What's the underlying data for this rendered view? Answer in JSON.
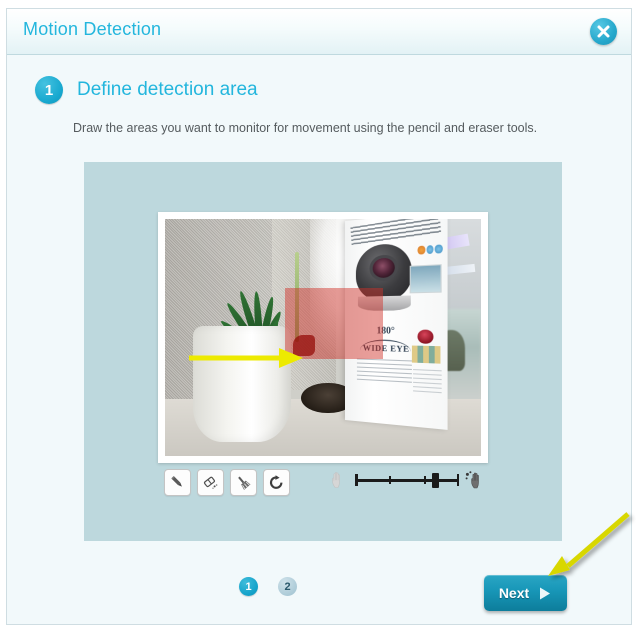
{
  "window": {
    "title": "Motion Detection",
    "close_icon": "close-icon",
    "accent_color": "#23b6dd",
    "titlebar_bg": "#e3f2f5",
    "body_bg": "#f2f9fb"
  },
  "step": {
    "number": "1",
    "title": "Define detection area",
    "description": "Draw the areas you want to monitor for movement using the pencil and eraser tools."
  },
  "preview": {
    "panel_bg": "#bdd8dd",
    "detection_overlay_color": "#d03028",
    "scene": {
      "poster_180": "180°",
      "poster_wide_eye": "WIDE EYE"
    }
  },
  "toolbar": {
    "tools": [
      {
        "name": "pencil-tool",
        "icon": "pencil-icon",
        "selected": false
      },
      {
        "name": "eraser-tool",
        "icon": "eraser-icon",
        "selected": false
      },
      {
        "name": "clear-brush-tool",
        "icon": "brush-icon",
        "selected": false
      },
      {
        "name": "reset-tool",
        "icon": "refresh-icon",
        "selected": false
      }
    ],
    "sensitivity": {
      "low_icon": "hand-still-icon",
      "high_icon": "hand-motion-icon",
      "value": 75,
      "min": 0,
      "max": 100,
      "ticks": [
        0,
        33,
        66,
        100
      ]
    }
  },
  "footer": {
    "pages": [
      {
        "label": "1",
        "active": true
      },
      {
        "label": "2",
        "active": false
      }
    ],
    "next_label": "Next",
    "next_icon": "play-triangle-icon",
    "next_color": "#1897b8"
  },
  "annotations": {
    "arrow_color": "#edea00",
    "arrow_photo": "arrow-right",
    "arrow_next": "arrow-down-left"
  }
}
